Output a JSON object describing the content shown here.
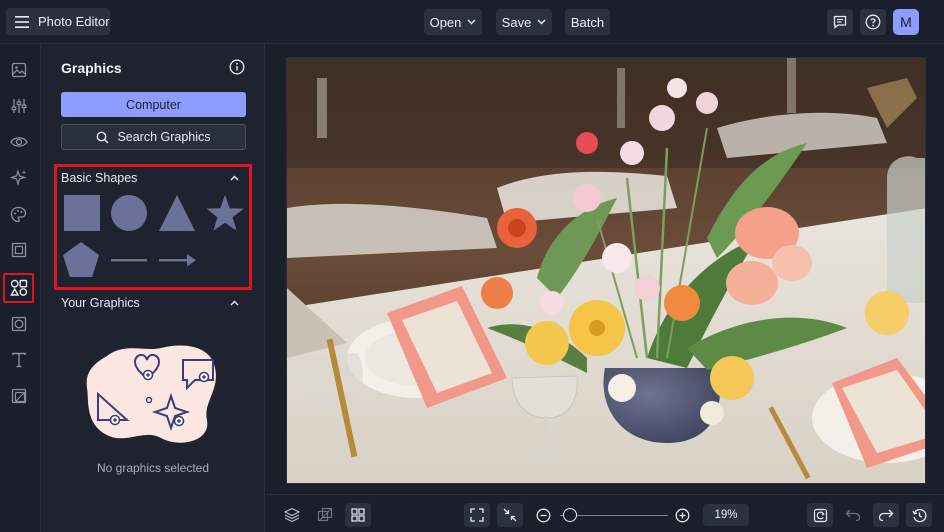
{
  "topbar": {
    "app_title": "Photo Editor",
    "menu_icon": "hamburger-menu-icon",
    "open_label": "Open",
    "save_label": "Save",
    "batch_label": "Batch",
    "feedback_icon": "feedback-icon",
    "help_icon": "help-icon",
    "avatar_initial": "M"
  },
  "rail": {
    "items": [
      {
        "icon": "image-icon"
      },
      {
        "icon": "adjustments-icon"
      },
      {
        "icon": "eye-icon"
      },
      {
        "icon": "sparkle-effects-icon"
      },
      {
        "icon": "palette-icon"
      },
      {
        "icon": "frame-icon"
      },
      {
        "icon": "graphics-shapes-icon",
        "active": true
      },
      {
        "icon": "overlay-icon"
      },
      {
        "icon": "text-icon"
      },
      {
        "icon": "texture-icon"
      }
    ]
  },
  "panel": {
    "title": "Graphics",
    "computer_label": "Computer",
    "search_label": "Search Graphics",
    "basic_shapes": {
      "heading": "Basic Shapes",
      "shapes": [
        "square",
        "circle",
        "triangle",
        "star",
        "pentagon",
        "line",
        "arrow"
      ]
    },
    "your_graphics": {
      "heading": "Your Graphics",
      "empty_text": "No graphics selected"
    }
  },
  "canvas": {
    "photo_subject": "floral centerpiece on table"
  },
  "bottombar": {
    "zoom_value": "19%",
    "zoom_fraction": 0.03
  },
  "colors": {
    "accent": "#8f9cff",
    "highlight": "#e0141e",
    "background": "#1b1f2b",
    "panel": "#1f2330",
    "shape_fill": "#6b7199"
  }
}
